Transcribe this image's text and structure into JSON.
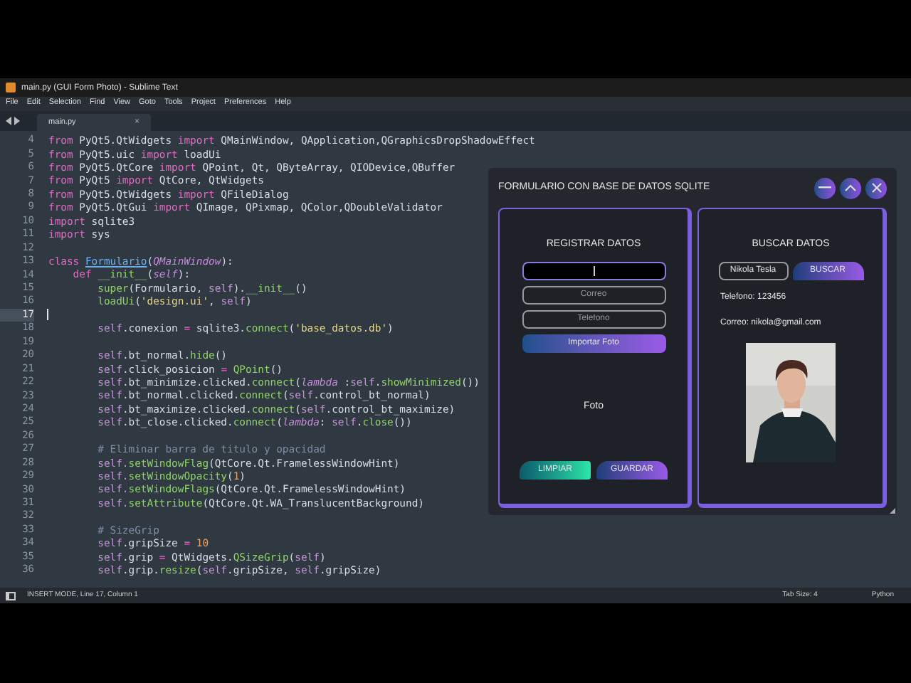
{
  "window": {
    "title": "main.py (GUI Form Photo) - Sublime Text"
  },
  "menu": [
    "File",
    "Edit",
    "Selection",
    "Find",
    "View",
    "Goto",
    "Tools",
    "Project",
    "Preferences",
    "Help"
  ],
  "tabs": [
    {
      "label": "main.py",
      "selected": true,
      "close": "×"
    }
  ],
  "editor": {
    "lines": [
      {
        "number": "4",
        "tokens": [
          {
            "kind": "kw",
            "text": "from"
          },
          {
            "kind": "plain",
            "text": " PyQt5.QtWidgets "
          },
          {
            "kind": "kw",
            "text": "import"
          },
          {
            "kind": "plain",
            "text": " QMainWindow, QApplication,QGraphicsDropShadowEffect"
          }
        ]
      },
      {
        "number": "5",
        "tokens": [
          {
            "kind": "kw",
            "text": "from"
          },
          {
            "kind": "plain",
            "text": " PyQt5.uic "
          },
          {
            "kind": "kw",
            "text": "import"
          },
          {
            "kind": "plain",
            "text": " loadUi"
          }
        ]
      },
      {
        "number": "6",
        "tokens": [
          {
            "kind": "kw",
            "text": "from"
          },
          {
            "kind": "plain",
            "text": " PyQt5.QtCore "
          },
          {
            "kind": "kw",
            "text": "import"
          },
          {
            "kind": "plain",
            "text": " QPoint, Qt, QByteArray, QIODevice,QBuffer"
          }
        ]
      },
      {
        "number": "7",
        "tokens": [
          {
            "kind": "kw",
            "text": "from"
          },
          {
            "kind": "plain",
            "text": " PyQt5 "
          },
          {
            "kind": "kw",
            "text": "import"
          },
          {
            "kind": "plain",
            "text": " QtCore, QtWidgets"
          }
        ]
      },
      {
        "number": "8",
        "tokens": [
          {
            "kind": "kw",
            "text": "from"
          },
          {
            "kind": "plain",
            "text": " PyQt5.QtWidgets "
          },
          {
            "kind": "kw",
            "text": "import"
          },
          {
            "kind": "plain",
            "text": " QFileDialog"
          }
        ]
      },
      {
        "number": "9",
        "tokens": [
          {
            "kind": "kw",
            "text": "from"
          },
          {
            "kind": "plain",
            "text": " PyQt5.QtGui "
          },
          {
            "kind": "kw",
            "text": "import"
          },
          {
            "kind": "plain",
            "text": " QImage, QPixmap, QColor,QDoubleValidator"
          }
        ]
      },
      {
        "number": "10",
        "tokens": [
          {
            "kind": "kw",
            "text": "import"
          },
          {
            "kind": "plain",
            "text": " sqlite3"
          }
        ]
      },
      {
        "number": "11",
        "tokens": [
          {
            "kind": "kw",
            "text": "import"
          },
          {
            "kind": "plain",
            "text": " sys"
          }
        ]
      },
      {
        "number": "12"
      },
      {
        "number": "13",
        "tokens": [
          {
            "kind": "kw",
            "text": "class "
          },
          {
            "kind": "cls",
            "text": "Formulario"
          },
          {
            "kind": "plain",
            "text": "("
          },
          {
            "kind": "it",
            "text": "QMainWindow"
          },
          {
            "kind": "plain",
            "text": "):"
          }
        ]
      },
      {
        "number": "14",
        "tokens": [
          {
            "kind": "kw",
            "text": "    def "
          },
          {
            "kind": "fn",
            "text": "__init__"
          },
          {
            "kind": "plain",
            "text": "("
          },
          {
            "kind": "it",
            "text": "self"
          },
          {
            "kind": "plain",
            "text": "):"
          }
        ]
      },
      {
        "number": "15",
        "tokens": [
          {
            "kind": "fn",
            "text": "        super"
          },
          {
            "kind": "plain",
            "text": "(Formulario, "
          },
          {
            "kind": "self",
            "text": "self"
          },
          {
            "kind": "plain",
            "text": ")."
          },
          {
            "kind": "fn",
            "text": "__init__"
          },
          {
            "kind": "plain",
            "text": "()"
          }
        ]
      },
      {
        "number": "16",
        "tokens": [
          {
            "kind": "fn",
            "text": "        loadUi"
          },
          {
            "kind": "plain",
            "text": "("
          },
          {
            "kind": "str",
            "text": "'design.ui'"
          },
          {
            "kind": "plain",
            "text": ", "
          },
          {
            "kind": "self",
            "text": "self"
          },
          {
            "kind": "plain",
            "text": ")"
          }
        ]
      },
      {
        "number": "17",
        "current": true
      },
      {
        "number": "18",
        "tokens": [
          {
            "kind": "self",
            "text": "        self"
          },
          {
            "kind": "plain",
            "text": ".conexion "
          },
          {
            "kind": "kw",
            "text": "="
          },
          {
            "kind": "plain",
            "text": " sqlite3."
          },
          {
            "kind": "fn",
            "text": "connect"
          },
          {
            "kind": "plain",
            "text": "("
          },
          {
            "kind": "str",
            "text": "'base_datos.db'"
          },
          {
            "kind": "plain",
            "text": ")"
          }
        ]
      },
      {
        "number": "19"
      },
      {
        "number": "20",
        "tokens": [
          {
            "kind": "self",
            "text": "        self"
          },
          {
            "kind": "plain",
            "text": ".bt_normal."
          },
          {
            "kind": "fn",
            "text": "hide"
          },
          {
            "kind": "plain",
            "text": "()"
          }
        ]
      },
      {
        "number": "21",
        "tokens": [
          {
            "kind": "self",
            "text": "        self"
          },
          {
            "kind": "plain",
            "text": ".click_posicion "
          },
          {
            "kind": "kw",
            "text": "="
          },
          {
            "kind": "fn",
            "text": " QPoint"
          },
          {
            "kind": "plain",
            "text": "()"
          }
        ]
      },
      {
        "number": "22",
        "tokens": [
          {
            "kind": "self",
            "text": "        self"
          },
          {
            "kind": "plain",
            "text": ".bt_minimize.clicked."
          },
          {
            "kind": "fn",
            "text": "connect"
          },
          {
            "kind": "plain",
            "text": "("
          },
          {
            "kind": "it",
            "text": "lambda"
          },
          {
            "kind": "plain",
            "text": " :"
          },
          {
            "kind": "self",
            "text": "self"
          },
          {
            "kind": "plain",
            "text": "."
          },
          {
            "kind": "fn",
            "text": "showMinimized"
          },
          {
            "kind": "plain",
            "text": "())"
          }
        ]
      },
      {
        "number": "23",
        "tokens": [
          {
            "kind": "self",
            "text": "        self"
          },
          {
            "kind": "plain",
            "text": ".bt_normal.clicked."
          },
          {
            "kind": "fn",
            "text": "connect"
          },
          {
            "kind": "plain",
            "text": "("
          },
          {
            "kind": "self",
            "text": "self"
          },
          {
            "kind": "plain",
            "text": ".control_bt_normal)"
          }
        ]
      },
      {
        "number": "24",
        "tokens": [
          {
            "kind": "self",
            "text": "        self"
          },
          {
            "kind": "plain",
            "text": ".bt_maximize.clicked."
          },
          {
            "kind": "fn",
            "text": "connect"
          },
          {
            "kind": "plain",
            "text": "("
          },
          {
            "kind": "self",
            "text": "self"
          },
          {
            "kind": "plain",
            "text": ".control_bt_maximize)"
          }
        ]
      },
      {
        "number": "25",
        "tokens": [
          {
            "kind": "self",
            "text": "        self"
          },
          {
            "kind": "plain",
            "text": ".bt_close.clicked."
          },
          {
            "kind": "fn",
            "text": "connect"
          },
          {
            "kind": "plain",
            "text": "("
          },
          {
            "kind": "it",
            "text": "lambda"
          },
          {
            "kind": "plain",
            "text": ": "
          },
          {
            "kind": "self",
            "text": "self"
          },
          {
            "kind": "plain",
            "text": "."
          },
          {
            "kind": "fn",
            "text": "close"
          },
          {
            "kind": "plain",
            "text": "())"
          }
        ]
      },
      {
        "number": "26"
      },
      {
        "number": "27",
        "tokens": [
          {
            "kind": "comment",
            "text": "        # Eliminar barra de titulo y opacidad"
          }
        ]
      },
      {
        "number": "28",
        "tokens": [
          {
            "kind": "self",
            "text": "        self."
          },
          {
            "kind": "fn",
            "text": "setWindowFlag"
          },
          {
            "kind": "plain",
            "text": "(QtCore.Qt.FramelessWindowHint)"
          }
        ]
      },
      {
        "number": "29",
        "tokens": [
          {
            "kind": "self",
            "text": "        self."
          },
          {
            "kind": "fn",
            "text": "setWindowOpacity"
          },
          {
            "kind": "plain",
            "text": "("
          },
          {
            "kind": "num",
            "text": "1"
          },
          {
            "kind": "plain",
            "text": ")"
          }
        ]
      },
      {
        "number": "30",
        "tokens": [
          {
            "kind": "self",
            "text": "        self."
          },
          {
            "kind": "fn",
            "text": "setWindowFlags"
          },
          {
            "kind": "plain",
            "text": "(QtCore.Qt.FramelessWindowHint)"
          }
        ]
      },
      {
        "number": "31",
        "tokens": [
          {
            "kind": "self",
            "text": "        self."
          },
          {
            "kind": "fn",
            "text": "setAttribute"
          },
          {
            "kind": "plain",
            "text": "(QtCore.Qt.WA_TranslucentBackground)"
          }
        ]
      },
      {
        "number": "32"
      },
      {
        "number": "33",
        "tokens": [
          {
            "kind": "comment",
            "text": "        # SizeGrip"
          }
        ]
      },
      {
        "number": "34",
        "tokens": [
          {
            "kind": "self",
            "text": "        self"
          },
          {
            "kind": "plain",
            "text": ".gripSize "
          },
          {
            "kind": "kw",
            "text": "="
          },
          {
            "kind": "num",
            "text": " 10"
          }
        ]
      },
      {
        "number": "35",
        "tokens": [
          {
            "kind": "self",
            "text": "        self"
          },
          {
            "kind": "plain",
            "text": ".grip "
          },
          {
            "kind": "kw",
            "text": "="
          },
          {
            "kind": "plain",
            "text": " QtWidgets."
          },
          {
            "kind": "fn",
            "text": "QSizeGrip"
          },
          {
            "kind": "plain",
            "text": "("
          },
          {
            "kind": "self",
            "text": "self"
          },
          {
            "kind": "plain",
            "text": ")"
          }
        ]
      },
      {
        "number": "36",
        "tokens": [
          {
            "kind": "self",
            "text": "        self"
          },
          {
            "kind": "plain",
            "text": ".grip."
          },
          {
            "kind": "fn",
            "text": "resize"
          },
          {
            "kind": "plain",
            "text": "("
          },
          {
            "kind": "self",
            "text": "self"
          },
          {
            "kind": "plain",
            "text": ".gripSize, "
          },
          {
            "kind": "self",
            "text": "self"
          },
          {
            "kind": "plain",
            "text": ".gripSize)"
          }
        ]
      }
    ]
  },
  "status_bar": {
    "mode": "INSERT MODE, Line 17, Column 1",
    "tab_size": "Tab Size: 4",
    "syntax": "Python"
  },
  "app": {
    "title": "FORMULARIO CON BASE DE DATOS SQLITE",
    "register": {
      "heading": "REGISTRAR DATOS",
      "fields": [
        {
          "focused": true
        },
        {
          "placeholder": "Correo",
          "focused": false
        },
        {
          "placeholder": "Telefono",
          "focused": false
        }
      ],
      "import_button": "Importar Foto",
      "photo_label": "Foto",
      "clear_button": "LIMPIAR",
      "save_button": "GUARDAR"
    },
    "search": {
      "heading": "BUSCAR DATOS",
      "field_value": "Nikola Tesla",
      "search_button": "BUSCAR",
      "phone": "Telefono: 123456",
      "email": "Correo: nikola@gmail.com"
    }
  }
}
